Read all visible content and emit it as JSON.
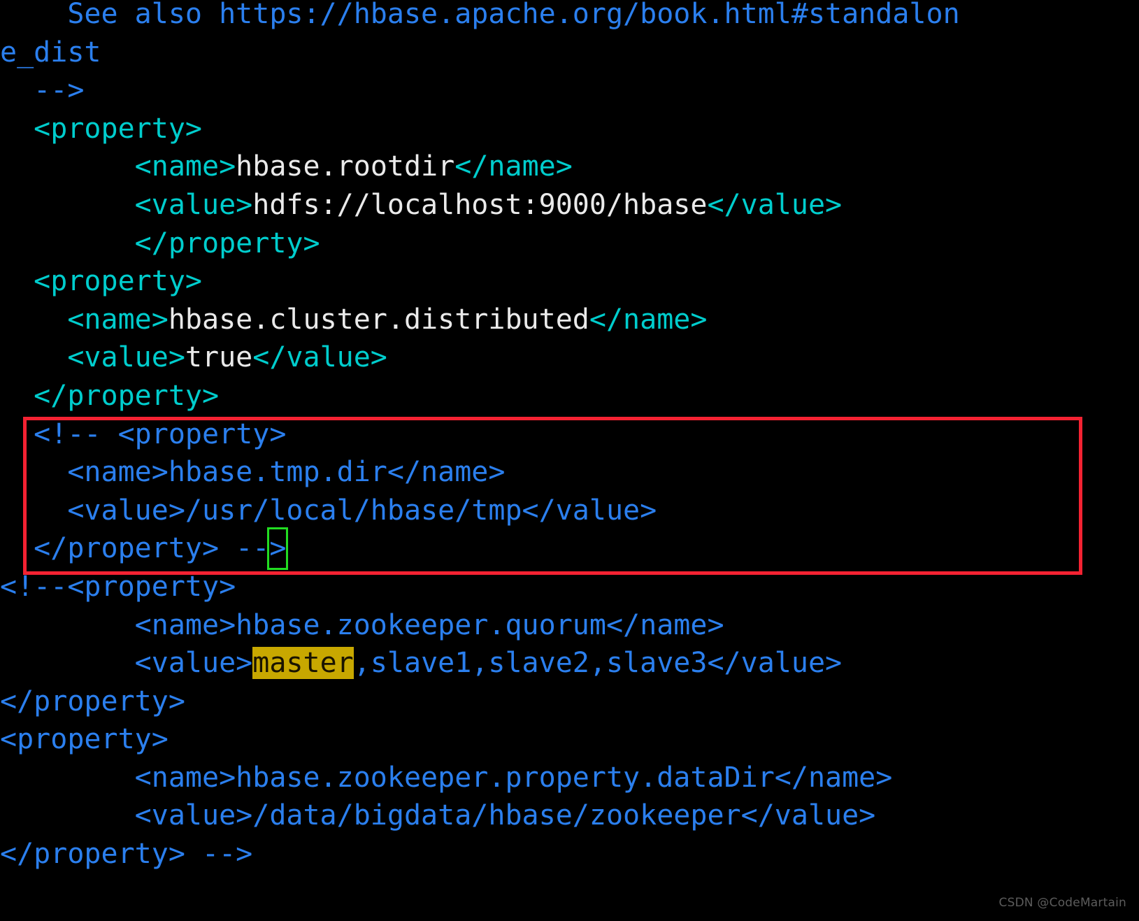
{
  "editor": {
    "background_color": "#000000",
    "font_size_px": 40,
    "colors": {
      "tag": "#00cdcd",
      "text": "#eaeaea",
      "comment": "#2b7fee",
      "highlight_bg": "#c8a800",
      "annotation_box": "#f42232",
      "cursor_outline": "#22dd22"
    }
  },
  "code_lines": [
    {
      "id": "line-see-also",
      "indent": 4,
      "kind": "comment",
      "text": "See also https://hbase.apache.org/book.html#standalon"
    },
    {
      "id": "line-see-also-wrap",
      "indent": 0,
      "kind": "comment",
      "text": "e_dist"
    },
    {
      "id": "line-comment-close",
      "indent": 2,
      "kind": "comment",
      "text": "-->"
    },
    {
      "id": "line-property-open-1",
      "indent": 2,
      "kind": "tag",
      "text": "<property>"
    },
    {
      "id": "line-name-rootdir",
      "indent": 8,
      "kind": "mixed",
      "open_tag": "<name>",
      "value": "hbase.rootdir",
      "close_tag": "</name>"
    },
    {
      "id": "line-value-rootdir",
      "indent": 8,
      "kind": "mixed",
      "open_tag": "<value>",
      "value": "hdfs://localhost:9000/hbase",
      "close_tag": "</value>"
    },
    {
      "id": "line-property-close-1",
      "indent": 8,
      "kind": "tag",
      "text": "</property>"
    },
    {
      "id": "line-property-open-2",
      "indent": 2,
      "kind": "tag",
      "text": "<property>"
    },
    {
      "id": "line-name-distributed",
      "indent": 4,
      "kind": "mixed",
      "open_tag": "<name>",
      "value": "hbase.cluster.distributed",
      "close_tag": "</name>"
    },
    {
      "id": "line-value-distributed",
      "indent": 4,
      "kind": "mixed",
      "open_tag": "<value>",
      "value": "true",
      "close_tag": "</value>"
    },
    {
      "id": "line-property-close-2",
      "indent": 2,
      "kind": "tag",
      "text": "</property>"
    },
    {
      "id": "line-cmt-property-open",
      "indent": 2,
      "kind": "comment",
      "text": "<!-- <property>"
    },
    {
      "id": "line-cmt-name-tmpdir",
      "indent": 4,
      "kind": "comment",
      "text": "<name>hbase.tmp.dir</name>"
    },
    {
      "id": "line-cmt-value-tmpdir",
      "indent": 4,
      "kind": "comment",
      "text": "<value>/usr/local/hbase/tmp</value>"
    },
    {
      "id": "line-cmt-property-close",
      "indent": 2,
      "kind": "comment-cursor",
      "before": "</property> --",
      "cursor_char": ">"
    },
    {
      "id": "line-cmt2-property-open",
      "indent": 0,
      "kind": "comment",
      "text": "<!--<property>"
    },
    {
      "id": "line-cmt2-name-quorum",
      "indent": 8,
      "kind": "comment",
      "text": "<name>hbase.zookeeper.quorum</name>"
    },
    {
      "id": "line-cmt2-value-quorum",
      "indent": 8,
      "kind": "comment-highlight",
      "before": "<value>",
      "highlight": "master",
      "after": ",slave1,slave2,slave3</value>"
    },
    {
      "id": "line-cmt2-property-close",
      "indent": 0,
      "kind": "comment",
      "text": "</property>"
    },
    {
      "id": "line-cmt2-property-open-b",
      "indent": 0,
      "kind": "comment",
      "text": "<property>"
    },
    {
      "id": "line-cmt2-name-datadir",
      "indent": 8,
      "kind": "comment",
      "text": "<name>hbase.zookeeper.property.dataDir</name>"
    },
    {
      "id": "line-cmt2-value-datadir",
      "indent": 8,
      "kind": "comment",
      "text": "<value>/data/bigdata/hbase/zookeeper</value>"
    },
    {
      "id": "line-cmt2-close-final",
      "indent": 0,
      "kind": "comment",
      "text": "</property> -->"
    }
  ],
  "annotations": {
    "red_box_label": "highlighted-comment-block",
    "cursor_label": "text-cursor"
  },
  "watermark": {
    "text": "CSDN @CodeMartain"
  }
}
